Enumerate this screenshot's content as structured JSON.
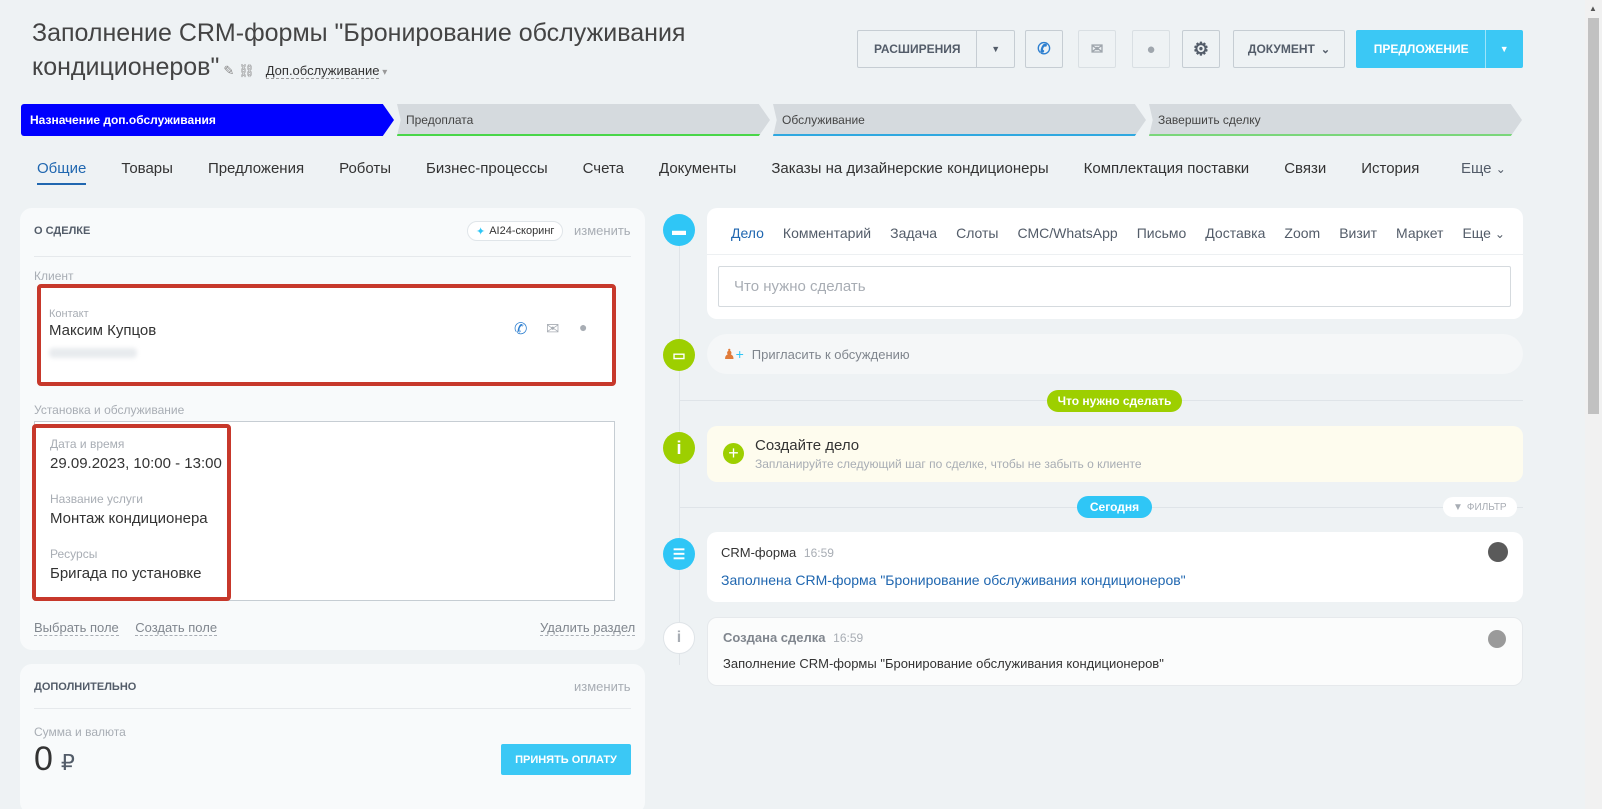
{
  "header": {
    "title": "Заполнение CRM-формы \"Бронирование обслуживания кондиционеров\"",
    "category": "Доп.обслуживание",
    "extensions_label": "РАСШИРЕНИЯ",
    "document_label": "ДОКУМЕНТ",
    "offer_label": "ПРЕДЛОЖЕНИЕ"
  },
  "stages": [
    {
      "label": "Назначение доп.обслуживания",
      "color": "#0000ff"
    },
    {
      "label": "Предоплата",
      "color": "#49d649"
    },
    {
      "label": "Обслуживание",
      "color": "#2fa8e0"
    },
    {
      "label": "Завершить сделку",
      "color": "#7ad67a"
    }
  ],
  "tabs": [
    "Общие",
    "Товары",
    "Предложения",
    "Роботы",
    "Бизнес-процессы",
    "Счета",
    "Документы",
    "Заказы на дизайнерские кондиционеры",
    "Комплектация поставки",
    "Связи",
    "История"
  ],
  "tabs_more": "Еще",
  "about": {
    "title": "О СДЕЛКЕ",
    "scoring": "AI24-скоринг",
    "edit": "изменить",
    "client_label": "Клиент",
    "contact_label": "Контакт",
    "contact_name": "Максим Купцов",
    "install_section": "Установка и обслуживание",
    "date_label": "Дата и время",
    "date_value": "29.09.2023, 10:00 - 13:00",
    "service_label": "Название услуги",
    "service_value": "Монтаж кондиционера",
    "resources_label": "Ресурсы",
    "resources_value": "Бригада по установке",
    "select_field": "Выбрать поле",
    "create_field": "Создать поле",
    "delete_section": "Удалить раздел"
  },
  "extra": {
    "title": "ДОПОЛНИТЕЛЬНО",
    "edit": "изменить",
    "sum_label": "Сумма и валюта",
    "sum_value": "0",
    "currency": "₽",
    "accept_payment": "ПРИНЯТЬ ОПЛАТУ"
  },
  "activity_tabs": [
    "Дело",
    "Комментарий",
    "Задача",
    "Слоты",
    "СМС/WhatsApp",
    "Письмо",
    "Доставка",
    "Zoom",
    "Визит",
    "Маркет"
  ],
  "activity_more": "Еще",
  "todo_placeholder": "Что нужно сделать",
  "invite": "Пригласить к обсуждению",
  "todo_pill": "Что нужно сделать",
  "create_task": {
    "title": "Создайте дело",
    "subtitle": "Запланируйте следующий шаг по сделке, чтобы не забыть о клиенте"
  },
  "today_pill": "Сегодня",
  "filter": "ФИЛЬТР",
  "events": [
    {
      "title": "CRM-форма",
      "time": "16:59",
      "text": "Заполнена CRM-форма \"Бронирование обслуживания кондиционеров\""
    },
    {
      "title": "Создана сделка",
      "time": "16:59",
      "text": "Заполнение CRM-формы \"Бронирование обслуживания кондиционеров\""
    }
  ]
}
